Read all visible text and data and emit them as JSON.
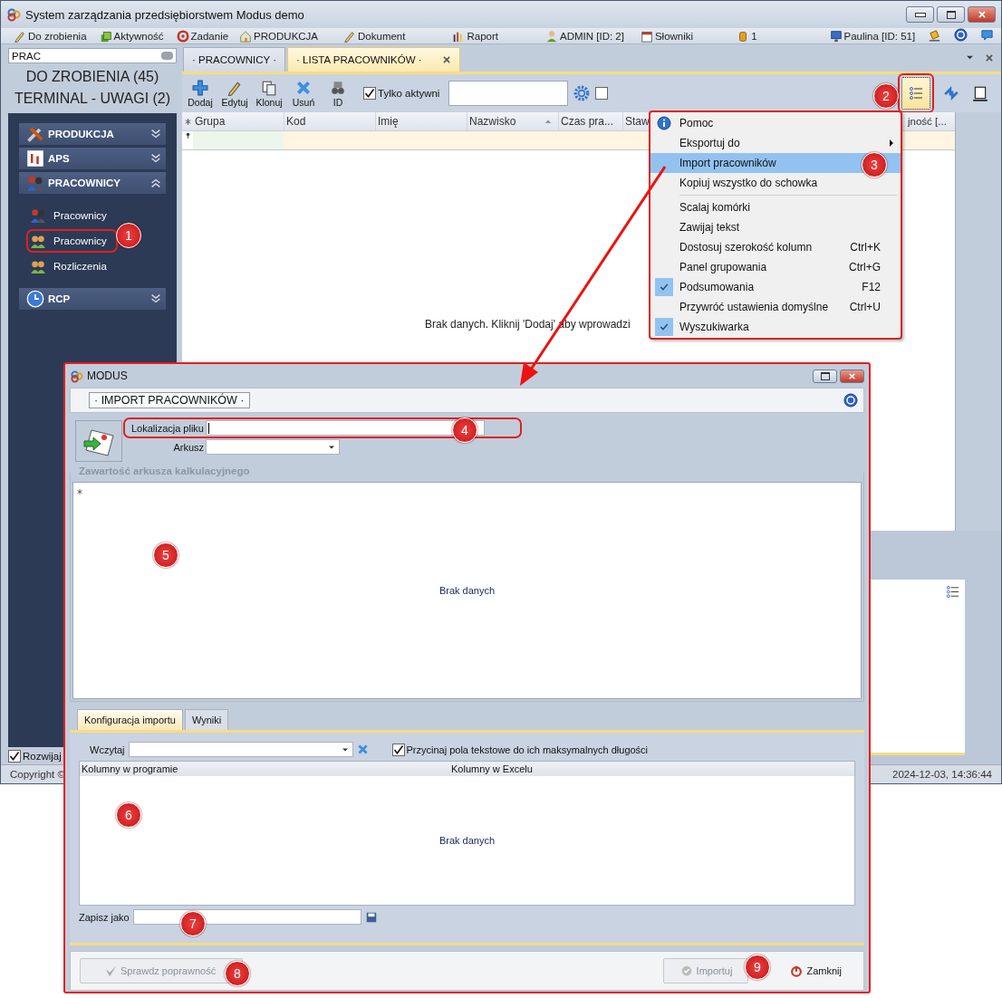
{
  "window": {
    "title": "System zarządzania przedsiębiorstwem Modus demo"
  },
  "toolbar": [
    {
      "label": "Do zrobienia"
    },
    {
      "label": "Aktywność"
    },
    {
      "label": "Zadanie"
    },
    {
      "label": "PRODUKCJA"
    },
    {
      "label": "Dokument"
    },
    {
      "label": "Raport"
    },
    {
      "label": "ADMIN [ID: 2]"
    },
    {
      "label": "Słowniki"
    },
    {
      "label": "1"
    },
    {
      "label": "Paulina [ID: 51]"
    }
  ],
  "sidebar": {
    "search": {
      "value": "PRAC"
    },
    "counters": [
      "DO ZROBIENIA (45)",
      "TERMINAL - UWAGI (2)"
    ],
    "groups": [
      {
        "label": "PRODUKCJA",
        "expanded": false
      },
      {
        "label": "APS",
        "expanded": false
      },
      {
        "label": "PRACOWNICY",
        "expanded": true,
        "children": [
          {
            "label": "Pracownicy"
          },
          {
            "label": "Pracownicy"
          },
          {
            "label": "Rozliczenia"
          }
        ]
      },
      {
        "label": "RCP",
        "expanded": false
      }
    ],
    "expand_all": {
      "label": "Rozwijaj",
      "checked": true
    }
  },
  "tabs": [
    {
      "label": "· PRACOWNICY ·",
      "selected": false,
      "closable": false
    },
    {
      "label": "· LISTA PRACOWNIKÓW ·",
      "selected": true,
      "closable": true
    }
  ],
  "grid_toolbar": {
    "buttons": [
      {
        "label": "Dodaj"
      },
      {
        "label": "Edytuj"
      },
      {
        "label": "Klonuj"
      },
      {
        "label": "Usuń"
      },
      {
        "label": "ID"
      }
    ],
    "active_only": {
      "label": "Tylko aktywni",
      "checked": true
    },
    "option_checked": false
  },
  "table": {
    "columns": [
      {
        "label": "Grupa",
        "sorted": false
      },
      {
        "label": "Kod",
        "sorted": false
      },
      {
        "label": "Imię",
        "sorted": false
      },
      {
        "label": "Nazwisko",
        "sorted": true
      },
      {
        "label": "Czas pra...",
        "sorted": false
      },
      {
        "label": "Staw",
        "sorted": false
      },
      {
        "label": "jność [...",
        "sorted": false
      }
    ],
    "empty_message": "Brak danych. Kliknij 'Dodaj' aby wprowadzi"
  },
  "context_menu": [
    {
      "label": "Pomoc",
      "checked": false,
      "highlighted": false
    },
    {
      "label": "Eksportuj do",
      "submenu": true,
      "checked": false,
      "highlighted": false
    },
    {
      "label": "Import pracowników",
      "checked": false,
      "highlighted": true
    },
    {
      "label": "Kopiuj wszystko do schowka",
      "checked": false,
      "highlighted": false
    },
    {
      "label": "Scalaj komórki",
      "separator_before": true,
      "checked": false,
      "highlighted": false
    },
    {
      "label": "Zawijaj tekst",
      "checked": false,
      "highlighted": false
    },
    {
      "label": "Dostosuj szerokość kolumn",
      "shortcut": "Ctrl+K",
      "checked": false,
      "highlighted": false
    },
    {
      "label": "Panel grupowania",
      "shortcut": "Ctrl+G",
      "checked": false,
      "highlighted": false
    },
    {
      "label": "Podsumowania",
      "shortcut": "F12",
      "checked": true,
      "highlighted": false
    },
    {
      "label": "Przywróć ustawienia domyślne",
      "shortcut": "Ctrl+U",
      "checked": false,
      "highlighted": false
    },
    {
      "label": "Wyszukiwarka",
      "checked": true,
      "highlighted": false
    }
  ],
  "status_bar": {
    "left": "Copyright ©",
    "datetime": "2024-12-03,  14:36:44"
  },
  "dialog": {
    "title": "MODUS",
    "header": "· IMPORT PRACOWNIKÓW ·",
    "file_label": "Lokalizacja pliku",
    "sheet_label": "Arkusz",
    "group_title": "Zawartość arkusza kalkulacyjnego",
    "sheet_empty": "Brak danych",
    "tabs": [
      {
        "label": "Konfiguracja importu",
        "selected": true
      },
      {
        "label": "Wyniki",
        "selected": false
      }
    ],
    "load_label": "Wczytaj",
    "trim": {
      "label": "Przycinaj pola tekstowe do ich maksymalnych długości",
      "checked": true
    },
    "mapping_columns": [
      "Kolumny w programie",
      "Kolumny w Excelu"
    ],
    "mapping_empty": "Brak danych",
    "save_label": "Zapisz jako",
    "buttons": [
      {
        "label": "Sprawdz poprawność",
        "disabled": true
      },
      {
        "label": "Importuj",
        "disabled": true
      },
      {
        "label": "Zamknij",
        "disabled": false
      }
    ]
  },
  "annotations": [
    {
      "number": "1"
    },
    {
      "number": "2"
    },
    {
      "number": "3"
    },
    {
      "number": "4"
    },
    {
      "number": "5"
    },
    {
      "number": "6"
    },
    {
      "number": "7"
    },
    {
      "number": "8"
    },
    {
      "number": "9"
    }
  ]
}
